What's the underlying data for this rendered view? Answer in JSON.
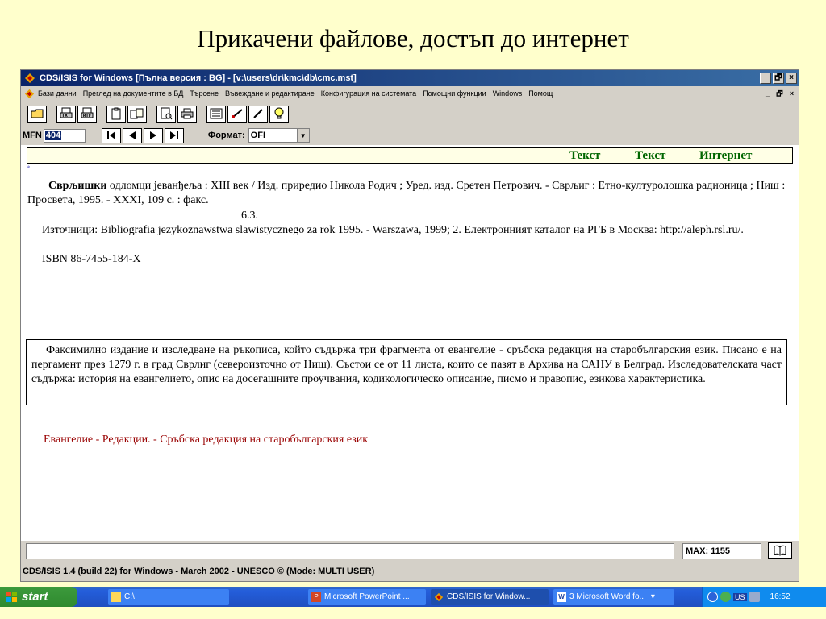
{
  "slide": {
    "title": "Прикачени файлове, достъп до интернет"
  },
  "window": {
    "title": "CDS/ISIS for Windows [Пълна версия : BG] - [v:\\users\\dr\\kmc\\db\\cmc.mst]",
    "minimize": "_",
    "restore": "🗗",
    "close": "×"
  },
  "menu": {
    "items": [
      "Бази данни",
      "Преглед на документите в БД",
      "Търсене",
      "Въвеждане и редактиране",
      "Конфигурация на системата",
      "Помощни функции",
      "Windows",
      "Помощ"
    ]
  },
  "toolbar": {
    "buttons": [
      "open-folder-icon",
      "print-txt-icon",
      "print-rtf-icon",
      "clipboard-icon",
      "copy-icon",
      "preview-icon",
      "printer-icon",
      "form-icon",
      "brush-icon",
      "pencil-icon",
      "lightbulb-icon"
    ],
    "txt_label": "TXT",
    "rtf_label": "RTF"
  },
  "nav": {
    "mfn_label": "MFN",
    "mfn_value": "404",
    "first": "|◀",
    "prev": "◀",
    "next": "▶",
    "last": "▶|",
    "format_label": "Формат:",
    "format_value": "OFI"
  },
  "record": {
    "links": [
      "Текст",
      "Текст",
      "Интернет"
    ],
    "star": "*",
    "title_bold": "Сврљишки",
    "title_rest": " одломци јеванђеља : XIII век / Изд. приредио Никола Родич ; Уред. изд. Сретен Петрович. - Сврљиг : Етно-културолошка радионица ; Ниш : Просвета, 1995. - XXXI, 109 с. : факс.",
    "class": "6.3.",
    "sources": "Източници: Bibliografia jezykoznawstwa slawistycznego za rok 1995. - Warszawa, 1999; 2. Електронният каталог на РГБ в Москва: http://aleph.rsl.ru/.",
    "isbn": "ISBN 86-7455-184-X",
    "abstract": "Факсимилно издание и изследване на ръкописа, който съдържа три фрагмента от евангелие - сръбска редакция на старобългарския език. Писано е на пергамент през 1279 г. в град Сврлиг (североизточно от Ниш). Състои се от 11 листа, които се пазят в Архива на САНУ в Белград. Изследователската част съдържа: история на евангелието, опис на досегашните проучвания, кодикологическо описание, писмо и правопис, езикова характеристика.",
    "subject": "Евангелие - Редакции. - Сръбска редакция на старобългарския език"
  },
  "status": {
    "max_label": "MAX: 1155",
    "version": "CDS/ISIS 1.4 (build 22) for Windows - March 2002 - UNESCO ©  (Mode: MULTI USER)"
  },
  "taskbar": {
    "start": "start",
    "tasks": [
      "C:\\",
      "Microsoft PowerPoint ...",
      "CDS/ISIS for Window...",
      "3 Microsoft Word fo..."
    ],
    "lang": "US",
    "time": "16:52"
  },
  "colors": {
    "slide_bg": "#ffffcc",
    "link_green": "#006600",
    "subject_red": "#990000",
    "titlebar": "#0a246a"
  }
}
